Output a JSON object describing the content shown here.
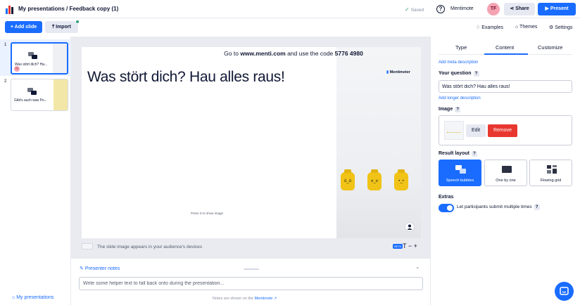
{
  "header": {
    "breadcrumb": "My presentations / Feedback copy (1)",
    "saved_label": "Saved",
    "help_label": "?",
    "username": "Mentimote",
    "avatar_initials": "TF",
    "share_label": "Share",
    "present_label": "Present"
  },
  "toolbar": {
    "add_slide_label": "+ Add slide",
    "import_label": "Import",
    "examples_label": "Examples",
    "themes_label": "Themes",
    "settings_label": "Settings"
  },
  "slides": [
    {
      "number": "1",
      "title": "Was stört dich? Ha...",
      "avatar": "TF",
      "selected": true
    },
    {
      "number": "2",
      "title": "Gibt's auch was Po...",
      "selected": false
    }
  ],
  "sidebar": {
    "my_presentations_label": "My presentations"
  },
  "slide": {
    "join_prefix": "Go to ",
    "join_url": "www.menti.com",
    "join_middle": " and use the code ",
    "join_code": "5776 4980",
    "question": "Was stört dich? Hau alles raus!",
    "brand": "Mentimeter",
    "press_hint": "Press S to show image"
  },
  "canvas_footer": {
    "hint": "The slide image appears in your audience's devices",
    "beta": "BETA",
    "text_size": "T − +"
  },
  "notes": {
    "header": "Presenter notes",
    "placeholder": "Write some helper text to fall back onto during the presentation...",
    "footer_prefix": "Notes are shown on the ",
    "footer_link": "Mentimote"
  },
  "panel": {
    "tabs": [
      "Type",
      "Content",
      "Customize"
    ],
    "active_tab": "Content",
    "add_meta": "Add meta description",
    "your_question_label": "Your question",
    "question_value": "Was stört dich? Hau alles raus!",
    "add_longer": "Add longer description",
    "image_label": "Image",
    "edit_label": "Edit",
    "remove_label": "Remove",
    "result_layout_label": "Result layout",
    "layouts": [
      {
        "label": "Speech bubbles",
        "selected": true
      },
      {
        "label": "One by one",
        "selected": false
      },
      {
        "label": "Flowing grid",
        "selected": false
      }
    ],
    "extras_label": "Extras",
    "multiple_submit_label": "Let participants submit multiple times",
    "multiple_submit_on": true
  },
  "colors": {
    "accent": "#196cff",
    "remove": "#e8372f",
    "lego": "#f0c316"
  }
}
